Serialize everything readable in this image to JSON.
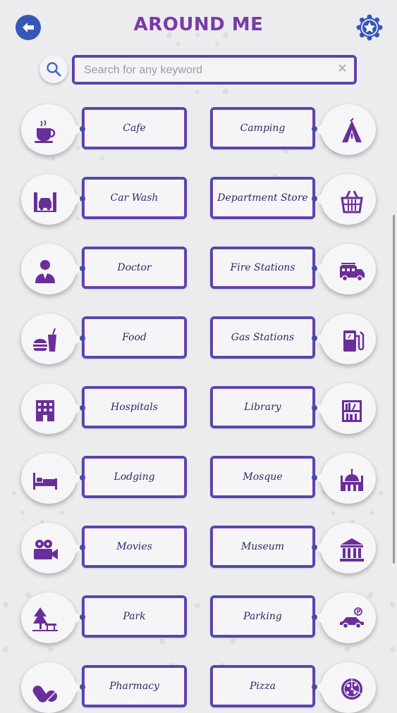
{
  "header": {
    "title": "AROUND ME"
  },
  "search": {
    "placeholder": "Search for any keyword",
    "clear": "×"
  },
  "colors": {
    "accent_purple": "#7a3aa7",
    "accent_blue": "#3557b7",
    "icon_purple": "#6a2e9a"
  },
  "categories": [
    {
      "label": "Cafe",
      "icon": "coffee-cup-icon"
    },
    {
      "label": "Camping",
      "icon": "tent-icon"
    },
    {
      "label": "Car Wash",
      "icon": "car-wash-icon"
    },
    {
      "label": "Department Store",
      "icon": "shopping-basket-icon"
    },
    {
      "label": "Doctor",
      "icon": "doctor-icon"
    },
    {
      "label": "Fire Stations",
      "icon": "fire-truck-icon"
    },
    {
      "label": "Food",
      "icon": "fast-food-icon"
    },
    {
      "label": "Gas Stations",
      "icon": "fuel-pump-icon"
    },
    {
      "label": "Hospitals",
      "icon": "hospital-building-icon"
    },
    {
      "label": "Library",
      "icon": "bookshelf-icon"
    },
    {
      "label": "Lodging",
      "icon": "bed-icon"
    },
    {
      "label": "Mosque",
      "icon": "mosque-icon"
    },
    {
      "label": "Movies",
      "icon": "film-camera-icon"
    },
    {
      "label": "Museum",
      "icon": "museum-icon"
    },
    {
      "label": "Park",
      "icon": "tree-bench-icon"
    },
    {
      "label": "Parking",
      "icon": "parking-car-icon"
    },
    {
      "label": "Pharmacy",
      "icon": "pills-icon"
    },
    {
      "label": "Pizza",
      "icon": "pizza-icon"
    }
  ]
}
